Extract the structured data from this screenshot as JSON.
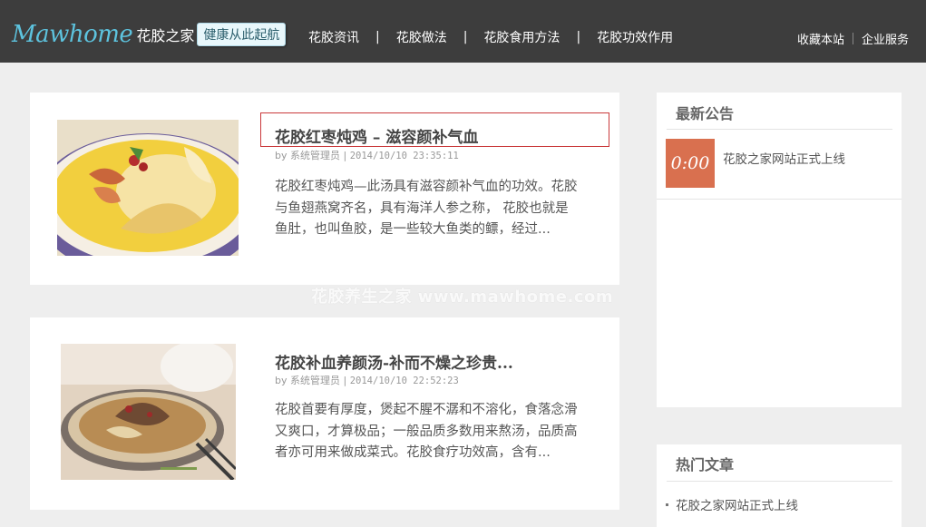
{
  "header": {
    "logo_main": "Mawhome",
    "logo_sub": "花胶之家",
    "logo_tag": "健康从此起航",
    "nav": [
      {
        "label": "花胶资讯"
      },
      {
        "label": "花胶做法"
      },
      {
        "label": "花胶食用方法"
      },
      {
        "label": "花胶功效作用"
      }
    ],
    "nav_separator": "|",
    "right_links": [
      {
        "label": "收藏本站"
      },
      {
        "label": "企业服务"
      }
    ]
  },
  "watermark": "花胶养生之家  www.mawhome.com",
  "articles": [
    {
      "title": "花胶红枣炖鸡 – 滋容颜补气血",
      "author": "by 系统管理员",
      "separator": "|",
      "time": "2014/10/10 23:35:11",
      "excerpt": "花胶红枣炖鸡—此汤具有滋容颜补气血的功效。花胶与鱼翅燕窝齐名，具有海洋人参之称， 花胶也就是鱼肚，也叫鱼胶，是一些较大鱼类的鳔，经过..."
    },
    {
      "title": "花胶补血养颜汤-补而不燥之珍贵...",
      "author": "by 系统管理员",
      "separator": "|",
      "time": "2014/10/10 22:52:23",
      "excerpt": "花胶首要有厚度，煲起不腥不潺和不溶化，食落念滑又爽口，才算极品；一般品质多数用来熬汤，品质高者亦可用来做成菜式。花胶食疗功效高，含有..."
    }
  ],
  "sidebar": {
    "notice": {
      "title": "最新公告",
      "items": [
        {
          "time": "0:00",
          "text": "花胶之家网站正式上线"
        }
      ]
    },
    "hot": {
      "title": "热门文章",
      "items": [
        {
          "text": "花胶之家网站正式上线"
        }
      ]
    }
  },
  "colors": {
    "header_bg": "#3d3d3d",
    "logo_blue": "#5dc3de",
    "highlight_border": "#c9393b",
    "notice_time_bg": "#d9704f",
    "page_bg": "#eeeeee"
  }
}
